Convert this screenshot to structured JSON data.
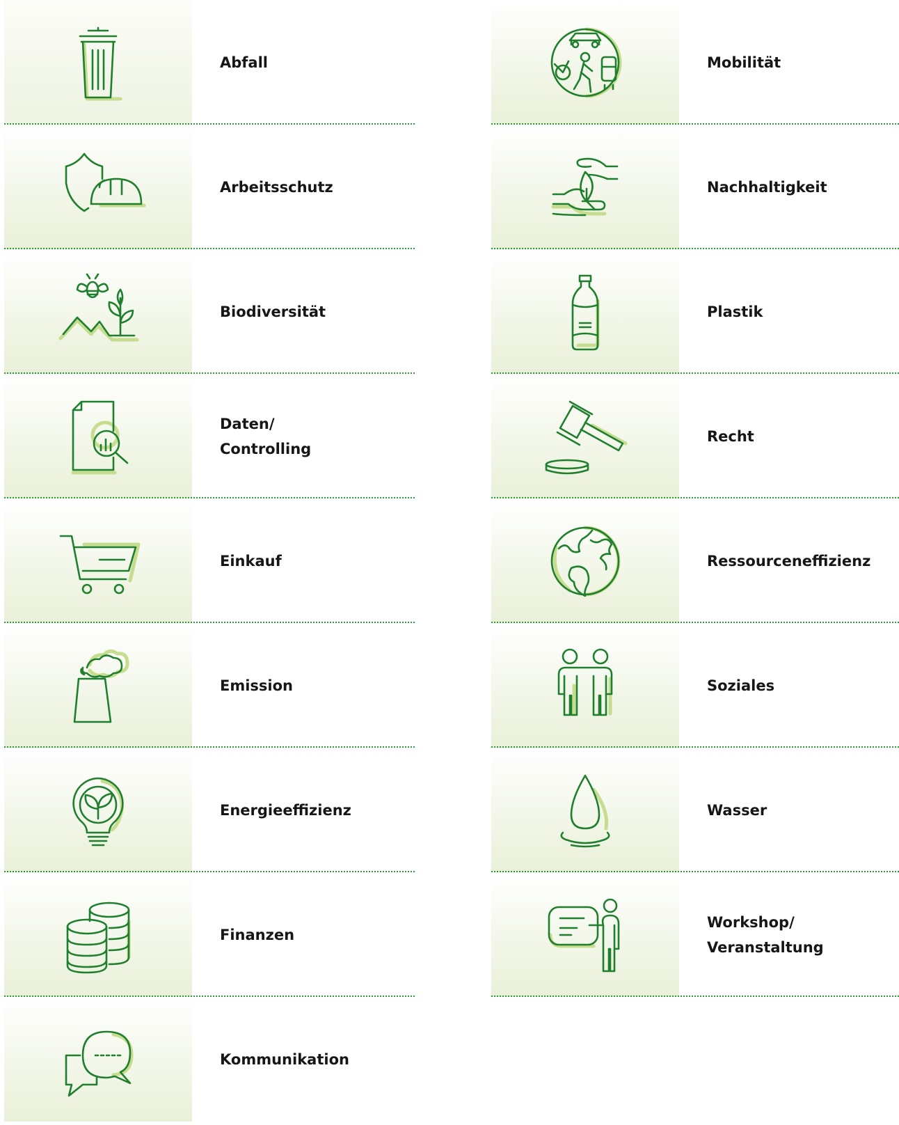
{
  "left_column": [
    {
      "label": "Abfall",
      "icon": "trash-bin-icon"
    },
    {
      "label": "Arbeitsschutz",
      "icon": "shield-helmet-icon"
    },
    {
      "label": "Biodiversität",
      "icon": "bee-plant-mountain-icon"
    },
    {
      "label": "Daten/\nControlling",
      "icon": "document-magnifier-chart-icon"
    },
    {
      "label": "Einkauf",
      "icon": "shopping-cart-icon"
    },
    {
      "label": "Emission",
      "icon": "chimney-smoke-icon"
    },
    {
      "label": "Energieeffizienz",
      "icon": "lightbulb-leaf-icon"
    },
    {
      "label": "Finanzen",
      "icon": "coin-stacks-icon"
    },
    {
      "label": "Kommunikation",
      "icon": "speech-bubbles-icon"
    }
  ],
  "right_column": [
    {
      "label": "Mobilität",
      "icon": "mobility-globe-icon"
    },
    {
      "label": "Nachhaltigkeit",
      "icon": "hands-leaf-icon"
    },
    {
      "label": "Plastik",
      "icon": "plastic-bottle-icon"
    },
    {
      "label": "Recht",
      "icon": "gavel-icon"
    },
    {
      "label": "Ressourceneffizienz",
      "icon": "earth-globe-icon"
    },
    {
      "label": "Soziales",
      "icon": "two-people-icon"
    },
    {
      "label": "Wasser",
      "icon": "water-drop-icon"
    },
    {
      "label": "Workshop/\nVeranstaltung",
      "icon": "presentation-board-icon"
    }
  ],
  "colors": {
    "stroke": "#1f7f2e",
    "highlight": "#c6dc8e",
    "background_tint": "#e9f0d8",
    "divider": "#2b9a3a"
  }
}
